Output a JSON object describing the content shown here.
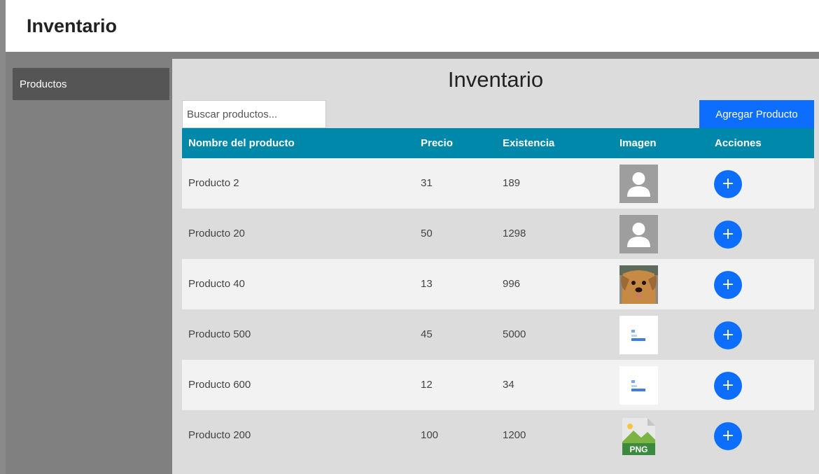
{
  "app": {
    "title": "Inventario"
  },
  "sidebar": {
    "items": [
      {
        "label": "Productos"
      }
    ]
  },
  "main": {
    "title": "Inventario",
    "search": {
      "placeholder": "Buscar productos...",
      "value": ""
    },
    "add_button_label": "Agregar Producto"
  },
  "table": {
    "headers": [
      "Nombre del producto",
      "Precio",
      "Existencia",
      "Imagen",
      "Acciones"
    ],
    "rows": [
      {
        "name": "Producto 2",
        "price": "31",
        "stock": "189",
        "image": "user-placeholder-icon",
        "action": "+"
      },
      {
        "name": "Producto 20",
        "price": "50",
        "stock": "1298",
        "image": "user-placeholder-icon",
        "action": "+"
      },
      {
        "name": "Producto 40",
        "price": "13",
        "stock": "996",
        "image": "dog-photo",
        "action": "+"
      },
      {
        "name": "Producto 500",
        "price": "45",
        "stock": "5000",
        "image": "screenshot-thumbnail",
        "action": "+"
      },
      {
        "name": "Producto 600",
        "price": "12",
        "stock": "34",
        "image": "screenshot-thumbnail",
        "action": "+"
      },
      {
        "name": "Producto 200",
        "price": "100",
        "stock": "1200",
        "image": "png-file-icon",
        "image_text": "PNG",
        "action": "+"
      }
    ]
  },
  "colors": {
    "header_bg": "#0088aa",
    "accent_blue": "#0d6efd",
    "sidebar_bg": "#808080",
    "sidebar_active": "#555555",
    "content_bg": "#dcdcdc",
    "row_light": "#f2f2f2"
  }
}
